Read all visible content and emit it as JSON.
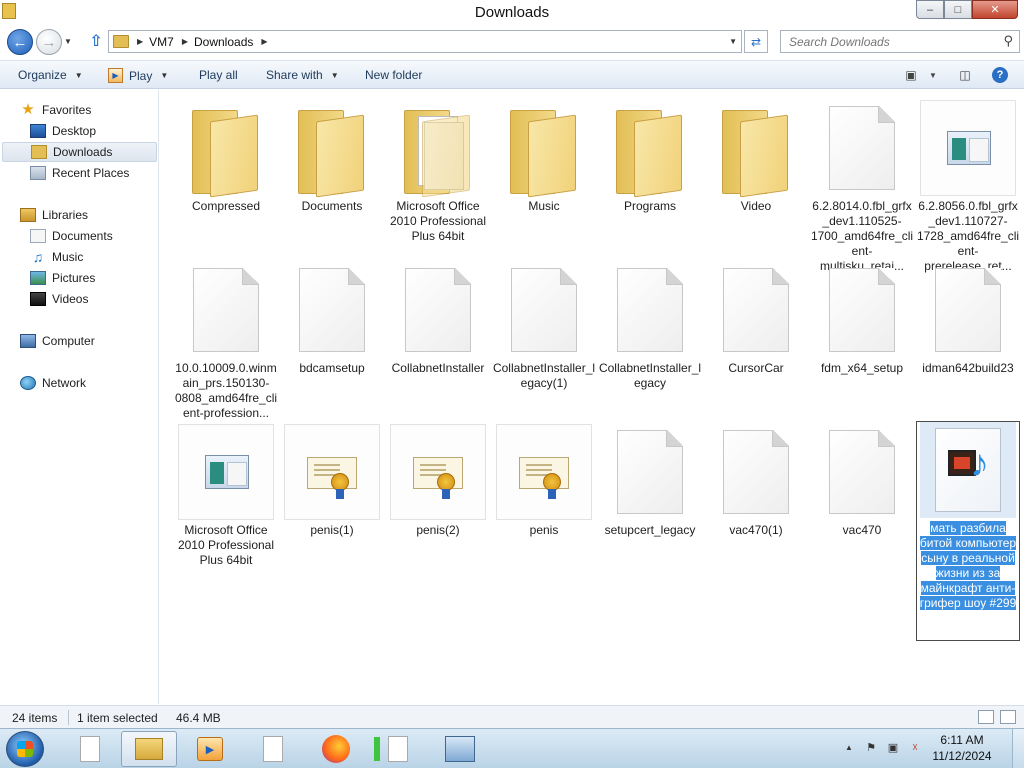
{
  "window": {
    "title": "Downloads"
  },
  "window_buttons": {
    "minimize": "–",
    "maximize": "□",
    "close": "✕"
  },
  "address": {
    "breadcrumbs": [
      "VM7",
      "Downloads"
    ],
    "search_placeholder": "Search Downloads"
  },
  "toolbar": {
    "organize": "Organize",
    "play": "Play",
    "play_all": "Play all",
    "share_with": "Share with",
    "new_folder": "New folder"
  },
  "nav": {
    "favorites": "Favorites",
    "desktop": "Desktop",
    "downloads": "Downloads",
    "recent_places": "Recent Places",
    "libraries": "Libraries",
    "documents": "Documents",
    "music": "Music",
    "pictures": "Pictures",
    "videos": "Videos",
    "computer": "Computer",
    "network": "Network"
  },
  "files": [
    {
      "name": "Compressed",
      "type": "folder"
    },
    {
      "name": "Documents",
      "type": "folder"
    },
    {
      "name": "Microsoft Office 2010 Professional Plus 64bit",
      "type": "folder-docs"
    },
    {
      "name": "Music",
      "type": "folder"
    },
    {
      "name": "Programs",
      "type": "folder"
    },
    {
      "name": "Video",
      "type": "folder"
    },
    {
      "name": "6.2.8014.0.fbl_grfx_dev1.110525-1700_amd64fre_client-multisku_retai...",
      "type": "file"
    },
    {
      "name": "6.2.8056.0.fbl_grfx_dev1.110727-1728_amd64fre_client-prerelease_ret...",
      "type": "setup"
    },
    {
      "name": "10.0.10009.0.winmain_prs.150130-0808_amd64fre_client-profession...",
      "type": "file"
    },
    {
      "name": "bdcamsetup",
      "type": "file"
    },
    {
      "name": "CollabnetInstaller",
      "type": "file"
    },
    {
      "name": "CollabnetInstaller_legacy(1)",
      "type": "file"
    },
    {
      "name": "CollabnetInstaller_legacy",
      "type": "file"
    },
    {
      "name": "CursorCar",
      "type": "file"
    },
    {
      "name": "fdm_x64_setup",
      "type": "file"
    },
    {
      "name": "idman642build23",
      "type": "file"
    },
    {
      "name": "Microsoft Office 2010 Professional Plus 64bit",
      "type": "setup"
    },
    {
      "name": "penis(1)",
      "type": "certificate"
    },
    {
      "name": "penis(2)",
      "type": "certificate"
    },
    {
      "name": "penis",
      "type": "certificate"
    },
    {
      "name": "setupcert_legacy",
      "type": "file"
    },
    {
      "name": "vac470(1)",
      "type": "file"
    },
    {
      "name": "vac470",
      "type": "file"
    },
    {
      "name": "мать разбила битой компьютер сыну в реальной жизни из за майнкрафт анти-грифер шоу #299",
      "type": "media",
      "selected": true
    }
  ],
  "status": {
    "item_count": "24 items",
    "selection": "1 item selected",
    "size": "46.4 MB"
  },
  "taskbar": {
    "time": "6:11 AM",
    "date": "11/12/2024"
  }
}
